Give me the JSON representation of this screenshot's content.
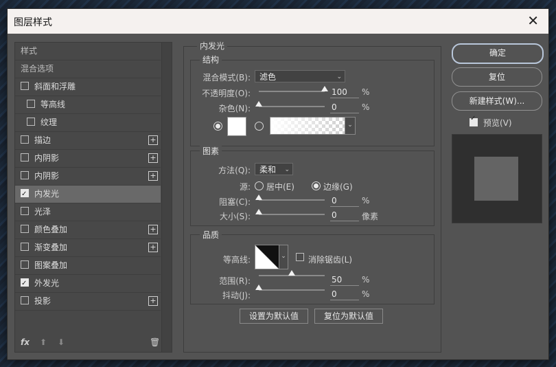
{
  "dialog": {
    "title": "图层样式"
  },
  "styles_list": {
    "items": [
      {
        "label": "样式",
        "type": "section"
      },
      {
        "label": "混合选项",
        "type": "section"
      },
      {
        "label": "斜面和浮雕",
        "checked": false
      },
      {
        "label": "等高线",
        "checked": false,
        "indent": true
      },
      {
        "label": "纹理",
        "checked": false,
        "indent": true
      },
      {
        "label": "描边",
        "checked": false,
        "plus": true
      },
      {
        "label": "内阴影",
        "checked": false,
        "plus": true
      },
      {
        "label": "内阴影",
        "checked": false,
        "plus": true
      },
      {
        "label": "内发光",
        "checked": true,
        "selected": true
      },
      {
        "label": "光泽",
        "checked": false
      },
      {
        "label": "颜色叠加",
        "checked": false,
        "plus": true
      },
      {
        "label": "渐变叠加",
        "checked": false,
        "plus": true
      },
      {
        "label": "图案叠加",
        "checked": false
      },
      {
        "label": "外发光",
        "checked": true
      },
      {
        "label": "投影",
        "checked": false,
        "plus": true
      }
    ],
    "footer": {
      "fx": "fx",
      "up": "⬆",
      "down": "⬇",
      "trash": "🗑"
    }
  },
  "panel": {
    "title": "内发光",
    "structure": {
      "title": "结构",
      "blend_mode_label": "混合模式(B):",
      "blend_mode_value": "滤色",
      "opacity_label": "不透明度(O):",
      "opacity_value": "100",
      "noise_label": "杂色(N):",
      "noise_value": "0",
      "percent": "%"
    },
    "elements": {
      "title": "图素",
      "method_label": "方法(Q):",
      "method_value": "柔和",
      "source_label": "源:",
      "source_center": "居中(E)",
      "source_edge": "边缘(G)",
      "choke_label": "阻塞(C):",
      "choke_value": "0",
      "size_label": "大小(S):",
      "size_value": "0",
      "size_unit": "像素",
      "percent": "%"
    },
    "quality": {
      "title": "品质",
      "contour_label": "等高线:",
      "antialias_label": "消除锯齿(L)",
      "range_label": "范围(R):",
      "range_value": "50",
      "jitter_label": "抖动(J):",
      "jitter_value": "0",
      "percent": "%"
    },
    "buttons": {
      "set_default": "设置为默认值",
      "reset_default": "复位为默认值"
    }
  },
  "actions": {
    "ok": "确定",
    "reset": "复位",
    "new_style": "新建样式(W)...",
    "preview_label": "预览(V)"
  },
  "colors": {
    "dialog_bg": "#535353",
    "titlebar_bg": "#f5f1ef",
    "ok_border": "#b9c7da"
  }
}
